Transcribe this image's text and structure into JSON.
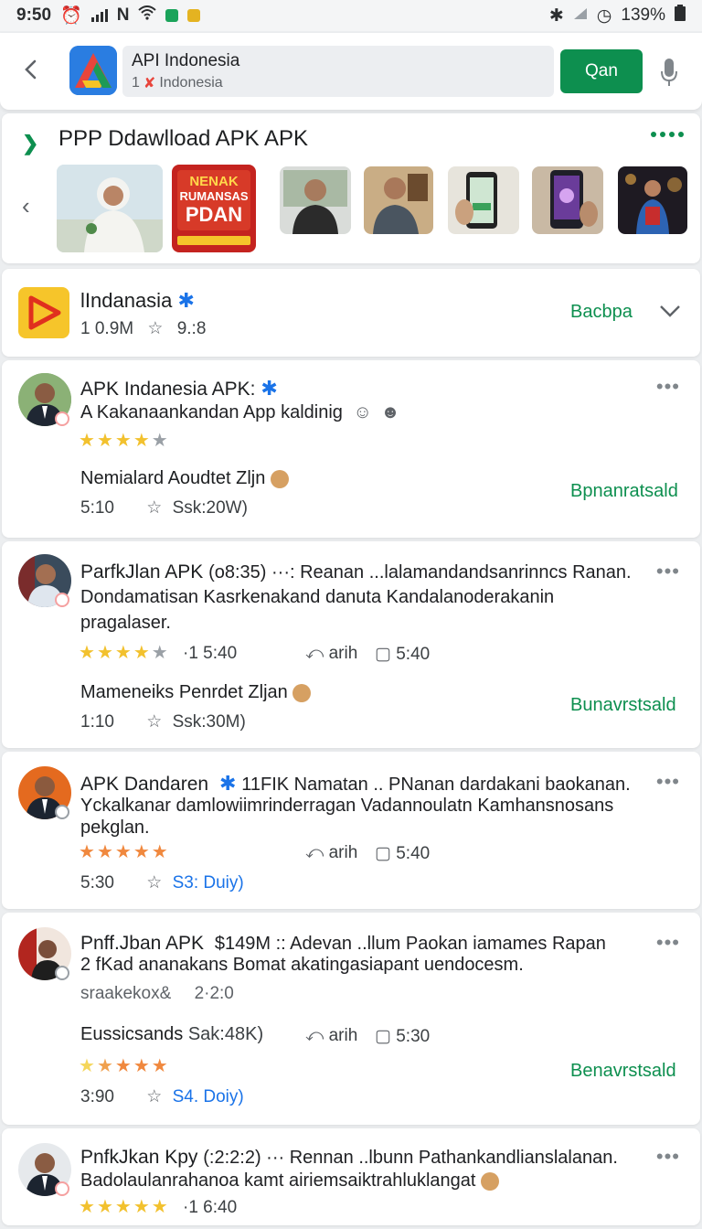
{
  "status_bar": {
    "time": "9:50",
    "battery": "139%"
  },
  "search": {
    "query": "API Indonesia",
    "sub_prefix": "1",
    "sub_text": "Indonesia",
    "go_label": "Qan"
  },
  "promo": {
    "title": "PPP Ddawlload APK APK",
    "banner_lines": [
      "NENAK",
      "RUMANSAS",
      "PDAN"
    ]
  },
  "app_row": {
    "title": "lIndanasia",
    "meta_left": "1 0.9M",
    "meta_right": "9.:8",
    "action": "Bacbpa"
  },
  "reviews": [
    {
      "name": "APK Indanesia APK:",
      "text": "A Kakanaankandan App kaldinig",
      "stars": 4,
      "sub_title": "Nemialard Aoudtet Zljn",
      "sub_time": "5:10",
      "sub_size": "Ssk:20W)",
      "action": "Bpnanratsald"
    },
    {
      "name": "ParfkJlan APK",
      "head_extra": "(o8:35)  ···:  Reanan ...lalamandandsanrinncs Ranan.",
      "text2": "Dondamatisan Kasrkenakand danuta Kandalanoderakanin",
      "text3": "pragalaser.",
      "rating_meta": "·1 5:40",
      "reply": "arih",
      "comment_time": "5:40",
      "sub_title": "Mameneiks Penrdet Zljan",
      "sub_time": "1:10",
      "sub_size": "Ssk:30M)",
      "action": "Bunavrstsald"
    },
    {
      "name": "APK Dandaren",
      "head_extra": "11FIK Namatan .. PNanan dardakani baokanan.",
      "text2": "Yckalkanar damlowiimrinderragan Vadannoulatn Kamhansnosans",
      "text3": "pekglan.",
      "reply": "arih",
      "comment_time": "5:40",
      "sub_time": "5:30",
      "sub_size": "S3: Duiy)"
    },
    {
      "name": "Pnff.Jban APK",
      "head_extra": "$149M  ::  Adevan ..llum  Paokan iamames Rapan",
      "text2": "2 fKad ananakans Bomat akatingasiapant uendocesm.",
      "text3": "sraakekox&",
      "text3_meta": "2·2:0",
      "sub_title": "Eussicsands",
      "sub_title_meta": "Sak:48K)",
      "reply": "arih",
      "comment_time": "5:30",
      "sub_time": "3:90",
      "sub_size": "S4. Doiy)",
      "action": "Benavrstsald"
    },
    {
      "name": "PnfkJkan Kpy",
      "head_extra": "(:2:2:2)  ···  Rennan ..lbunn Pathankandlianslalanan.",
      "text2": "Badolaulanrahanoa kamt airiemsaiktrahluklangat",
      "rating_meta": "·1 6:40"
    }
  ],
  "colors": {
    "accent_green": "#0d8f4f",
    "star_gold": "#f2c12e",
    "star_orange": "#f0883e",
    "verified_blue": "#1a73e8"
  },
  "icons": [
    "back-arrow-icon",
    "mic-icon",
    "verified-icon",
    "star-icon",
    "reply-icon",
    "comment-icon",
    "more-icon",
    "chevron-down-icon"
  ]
}
